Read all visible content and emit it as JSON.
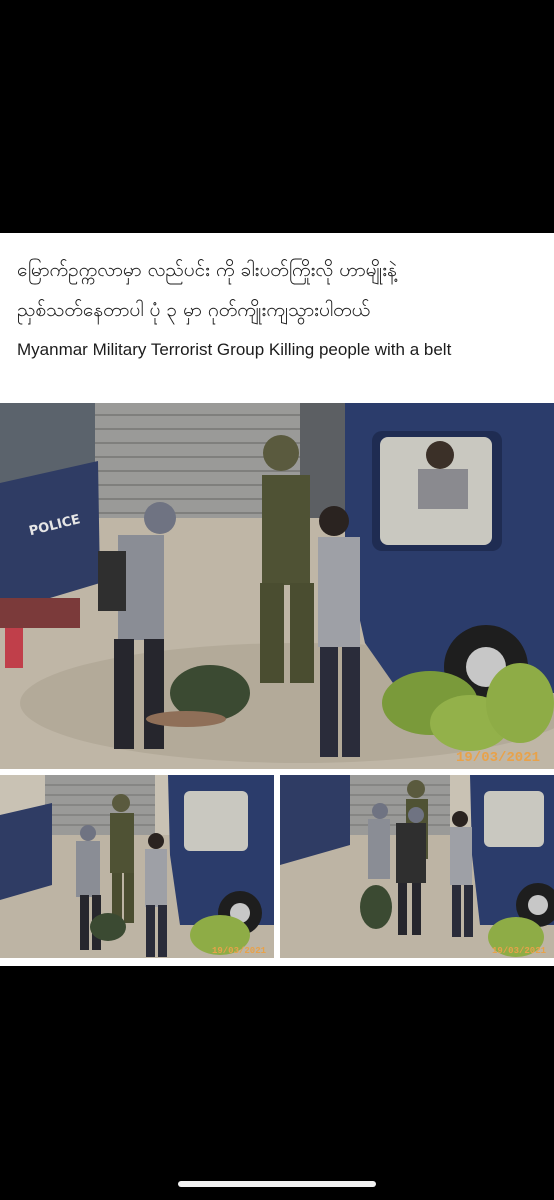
{
  "post": {
    "caption_burmese_line1": "မြောက်ဥက္ကလာမှာ လည်ပင်း ကို ခါးပတ်ကြိုးလို ဟာမျိုးနဲ့",
    "caption_burmese_line2": "ညှစ်သတ်နေတာပါ ပုံ ၃ မှာ ဂုတ်ကျိုးကျသွားပါတယ်",
    "caption_english": "Myanmar Military Terrorist Group Killing people with a belt"
  },
  "photos": {
    "main_date_stamp": "19/03/2021",
    "left_date_stamp": "19/03/2021",
    "right_date_stamp": "19/03/2021",
    "truck_text": "POLICE"
  },
  "colors": {
    "background": "#000000",
    "card": "#ffffff",
    "date_stamp": "#e8a24a",
    "truck": "#2c3d6a"
  },
  "icons": {
    "home_indicator": "home-indicator-bar"
  }
}
